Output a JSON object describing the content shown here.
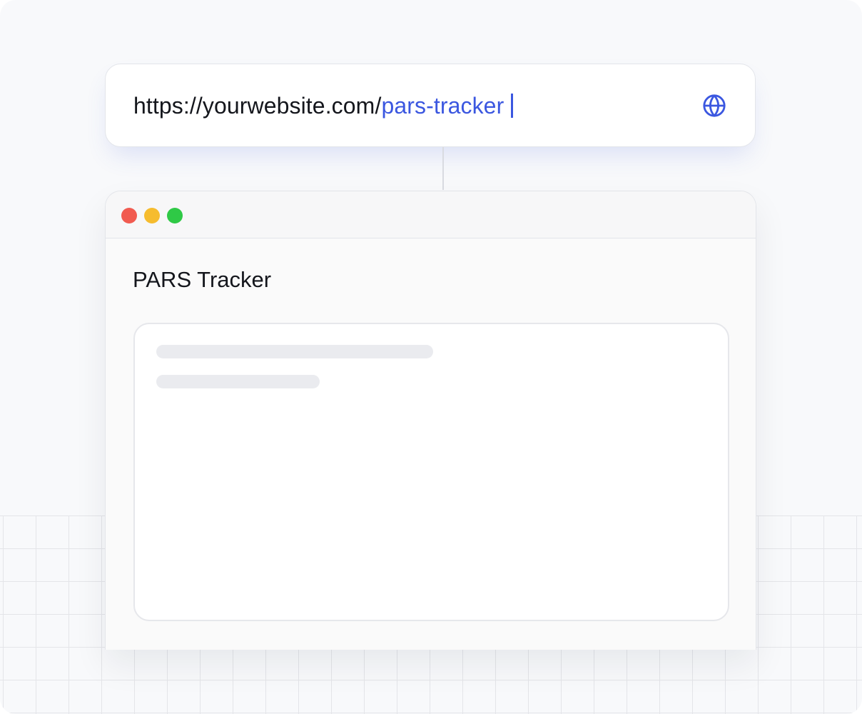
{
  "address_bar": {
    "url_base": "https://yourwebsite.com/",
    "url_path": "pars-tracker",
    "icon": "globe-icon",
    "accent_color": "#3b57e0"
  },
  "browser_window": {
    "controls": [
      {
        "name": "close",
        "color": "#f15b50"
      },
      {
        "name": "minimize",
        "color": "#f6bc2e"
      },
      {
        "name": "maximize",
        "color": "#2fc946"
      }
    ],
    "page_title": "PARS Tracker",
    "content_state": "loading-skeleton"
  }
}
